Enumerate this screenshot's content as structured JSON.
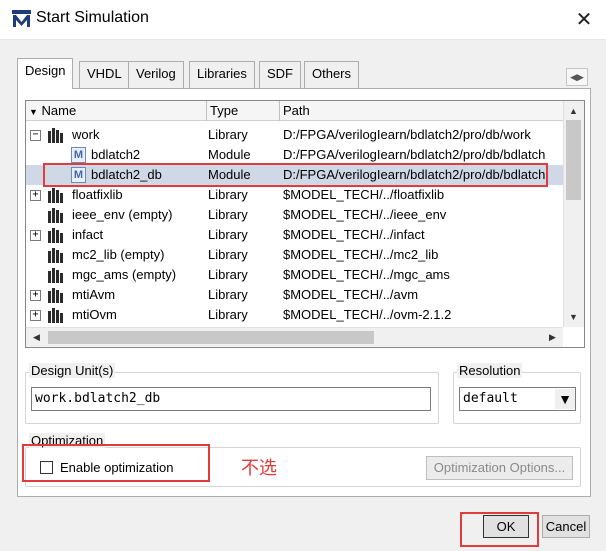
{
  "window": {
    "title": "Start Simulation",
    "close_glyph": "✕",
    "logo_glyph": "M"
  },
  "tabs": [
    {
      "label": "Design",
      "active": true
    },
    {
      "label": "VHDL",
      "active": false
    },
    {
      "label": "Verilog",
      "active": false
    },
    {
      "label": "Libraries",
      "active": false
    },
    {
      "label": "SDF",
      "active": false
    },
    {
      "label": "Others",
      "active": false
    }
  ],
  "tab_scroll": {
    "left": "◀",
    "right": "▶"
  },
  "library_list": {
    "headers": {
      "sort_glyph": "▼",
      "name": "Name",
      "type": "Type",
      "path": "Path"
    },
    "rows": [
      {
        "expander": "−",
        "icon": "library-icon",
        "name": "work",
        "type": "Library",
        "path": "D:/FPGA/verilogIearn/bdlatch2/pro/db/work"
      },
      {
        "expander": "",
        "icon": "module-icon",
        "name": "bdlatch2",
        "type": "Module",
        "path": "D:/FPGA/verilogIearn/bdlatch2/pro/db/bdlatch"
      },
      {
        "expander": "",
        "icon": "module-icon",
        "name": "bdlatch2_db",
        "type": "Module",
        "path": "D:/FPGA/verilogIearn/bdlatch2/pro/db/bdlatch"
      },
      {
        "expander": "+",
        "icon": "library-icon",
        "name": "floatfixlib",
        "type": "Library",
        "path": "$MODEL_TECH/../floatfixlib"
      },
      {
        "expander": "",
        "icon": "library-icon",
        "name": "ieee_env  (empty)",
        "type": "Library",
        "path": "$MODEL_TECH/../ieee_env"
      },
      {
        "expander": "+",
        "icon": "library-icon",
        "name": "infact",
        "type": "Library",
        "path": "$MODEL_TECH/../infact"
      },
      {
        "expander": "",
        "icon": "library-icon",
        "name": "mc2_lib  (empty)",
        "type": "Library",
        "path": "$MODEL_TECH/../mc2_lib"
      },
      {
        "expander": "",
        "icon": "library-icon",
        "name": "mgc_ams  (empty)",
        "type": "Library",
        "path": "$MODEL_TECH/../mgc_ams"
      },
      {
        "expander": "+",
        "icon": "library-icon",
        "name": "mtiAvm",
        "type": "Library",
        "path": "$MODEL_TECH/../avm"
      },
      {
        "expander": "+",
        "icon": "library-icon",
        "name": "mtiOvm",
        "type": "Library",
        "path": "$MODEL_TECH/../ovm-2.1.2"
      }
    ],
    "scroll_up": "▲",
    "scroll_down": "▼",
    "scroll_left": "◀",
    "scroll_right": "▶"
  },
  "design_unit": {
    "label": "Design Unit(s)",
    "value": "work.bdlatch2_db"
  },
  "resolution": {
    "label": "Resolution",
    "value": "default",
    "arrow": "▼"
  },
  "optimization": {
    "label": "Optimization",
    "checkbox_label": "Enable optimization",
    "checked": false,
    "options_button": "Optimization Options..."
  },
  "annotation_text": "不选",
  "buttons": {
    "ok": "OK",
    "cancel": "Cancel"
  },
  "colors": {
    "highlight": "#e23b3b",
    "selected_row": "#cfd8e6"
  }
}
